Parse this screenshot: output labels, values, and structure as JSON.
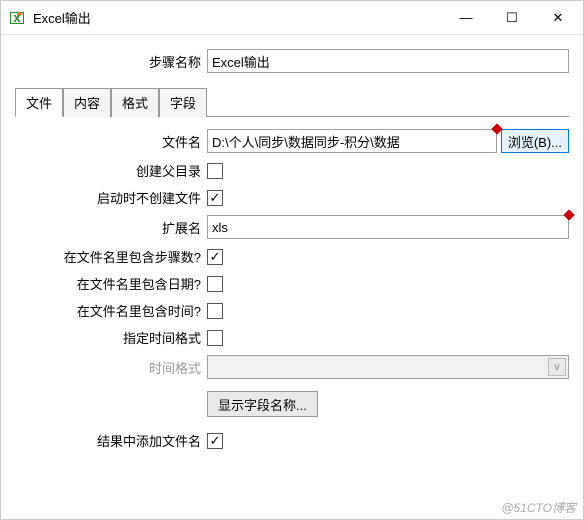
{
  "window": {
    "title": "Excel输出",
    "minimize": "—",
    "maximize": "☐",
    "close": "✕"
  },
  "step": {
    "label": "步骤名称",
    "value": "Excel输出"
  },
  "tabs": {
    "t0": "文件",
    "t1": "内容",
    "t2": "格式",
    "t3": "字段"
  },
  "fields": {
    "filename": {
      "label": "文件名",
      "value": "D:\\个人\\同步\\数据同步-积分\\数据"
    },
    "browse": "浏览(B)...",
    "createParent": {
      "label": "创建父目录"
    },
    "noCreateAtStartup": {
      "label": "启动时不创建文件"
    },
    "extension": {
      "label": "扩展名",
      "value": "xls"
    },
    "includeStep": {
      "label": "在文件名里包含步骤数?"
    },
    "includeDate": {
      "label": "在文件名里包含日期?"
    },
    "includeTime": {
      "label": "在文件名里包含时间?"
    },
    "specifyFormat": {
      "label": "指定时间格式"
    },
    "timeFormat": {
      "label": "时间格式"
    },
    "showButton": "显示字段名称...",
    "addToResult": {
      "label": "结果中添加文件名"
    }
  },
  "watermark": "@51CTO博客"
}
